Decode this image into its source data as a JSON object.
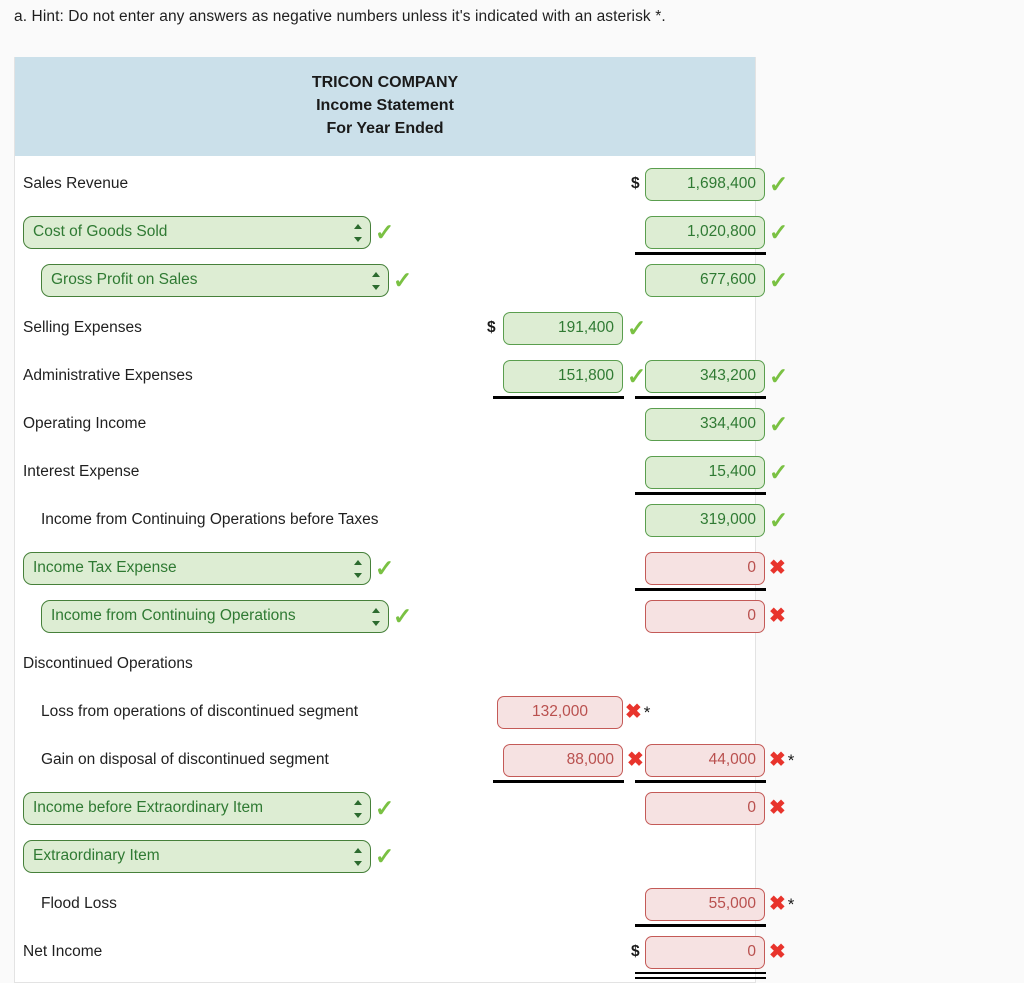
{
  "hint": "a. Hint: Do not enter any answers as negative numbers unless it's indicated with an asterisk *.",
  "statement": {
    "header": {
      "company": "TRICON COMPANY",
      "title": "Income Statement",
      "period": "For Year Ended"
    },
    "colors": {
      "header_bg": "#cbe0ea",
      "correct_border": "#5a9e4e",
      "correct_bg": "#ddedd3",
      "correct_text": "#2f7a33",
      "incorrect_border": "#c45a57",
      "incorrect_bg": "#f6e2e2",
      "incorrect_text": "#b9504e",
      "tick": "#7ac143",
      "cross": "#e8342c"
    },
    "symbols": {
      "dollar": "$",
      "tick": "✓",
      "cross": "✖",
      "asterisk": "*"
    },
    "rows": [
      {
        "id": "sales-revenue",
        "kind": "label",
        "label": "Sales Revenue",
        "indent": 0,
        "right": {
          "value": "1,698,400",
          "status": "correct",
          "dollar": "$"
        }
      },
      {
        "id": "cost-of-goods-sold",
        "kind": "select",
        "label": "Cost of Goods Sold",
        "indent": 0,
        "select_status": "correct",
        "right": {
          "value": "1,020,800",
          "status": "correct"
        },
        "rule_right": "single"
      },
      {
        "id": "gross-profit-on-sales",
        "kind": "select",
        "label": "Gross Profit on Sales",
        "indent": 1,
        "select_status": "correct",
        "right": {
          "value": "677,600",
          "status": "correct"
        }
      },
      {
        "id": "selling-expenses",
        "kind": "label",
        "label": "Selling Expenses",
        "indent": 0,
        "mid": {
          "value": "191,400",
          "status": "correct",
          "dollar": "$"
        }
      },
      {
        "id": "administrative-expenses",
        "kind": "label",
        "label": "Administrative Expenses",
        "indent": 0,
        "mid": {
          "value": "151,800",
          "status": "correct"
        },
        "right": {
          "value": "343,200",
          "status": "correct"
        },
        "rule_mid": "single",
        "rule_right": "single"
      },
      {
        "id": "operating-income",
        "kind": "label",
        "label": "Operating Income",
        "indent": 0,
        "right": {
          "value": "334,400",
          "status": "correct"
        }
      },
      {
        "id": "interest-expense",
        "kind": "label",
        "label": "Interest Expense",
        "indent": 0,
        "right": {
          "value": "15,400",
          "status": "correct"
        },
        "rule_right": "single"
      },
      {
        "id": "income-continuing-before-taxes",
        "kind": "label",
        "label": "Income from Continuing Operations before Taxes",
        "indent": 1,
        "right": {
          "value": "319,000",
          "status": "correct"
        }
      },
      {
        "id": "income-tax-expense",
        "kind": "select",
        "label": "Income Tax Expense",
        "indent": 0,
        "select_status": "correct",
        "right": {
          "value": "0",
          "status": "incorrect"
        },
        "rule_right": "single"
      },
      {
        "id": "income-from-continuing-operations",
        "kind": "select",
        "label": "Income from Continuing Operations",
        "indent": 1,
        "select_status": "correct",
        "right": {
          "value": "0",
          "status": "incorrect"
        }
      },
      {
        "id": "discontinued-operations",
        "kind": "label",
        "label": "Discontinued Operations",
        "indent": 0
      },
      {
        "id": "loss-from-operations-discontinued",
        "kind": "label",
        "label": "Loss from operations of discontinued segment",
        "indent": 1,
        "mid": {
          "value": "132,000",
          "status": "incorrect",
          "align": "center",
          "wide": true,
          "asterisk": "*"
        }
      },
      {
        "id": "gain-on-disposal-discontinued",
        "kind": "label",
        "label": "Gain on disposal of discontinued segment",
        "indent": 1,
        "mid": {
          "value": "88,000",
          "status": "incorrect"
        },
        "right": {
          "value": "44,000",
          "status": "incorrect",
          "asterisk": "*"
        },
        "rule_mid": "single",
        "rule_right": "single"
      },
      {
        "id": "income-before-extraordinary-item",
        "kind": "select",
        "label": "Income before Extraordinary Item",
        "indent": 0,
        "select_status": "correct",
        "right": {
          "value": "0",
          "status": "incorrect"
        }
      },
      {
        "id": "extraordinary-item",
        "kind": "select",
        "label": "Extraordinary Item",
        "indent": 0,
        "select_status": "correct"
      },
      {
        "id": "flood-loss",
        "kind": "label",
        "label": "Flood Loss",
        "indent": 1,
        "right": {
          "value": "55,000",
          "status": "incorrect",
          "asterisk": "*"
        },
        "rule_right": "single"
      },
      {
        "id": "net-income",
        "kind": "label",
        "label": "Net Income",
        "indent": 0,
        "right": {
          "value": "0",
          "status": "incorrect",
          "dollar": "$"
        },
        "rule_right": "double"
      }
    ]
  }
}
